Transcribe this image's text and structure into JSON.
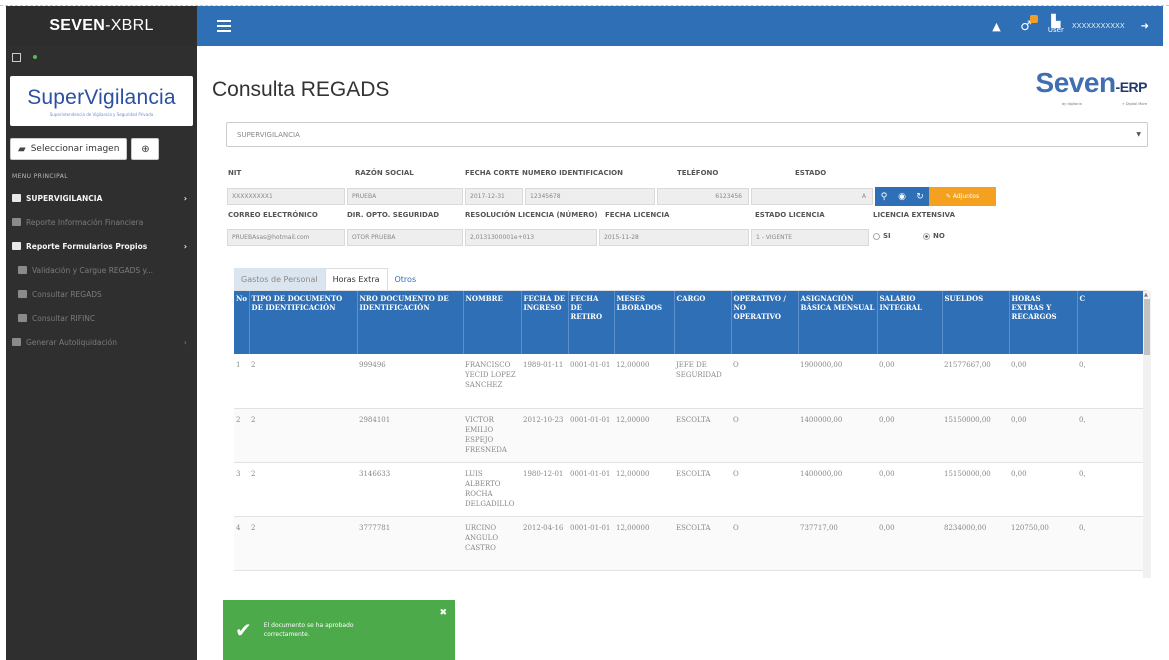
{
  "header": {
    "brand_strong": "SEVEN",
    "brand_rest": "-XBRL",
    "user_caption": "User",
    "username": "XXXXXXXXXXX"
  },
  "sidebar": {
    "logo_title": "SuperVigilancia",
    "logo_sub": "Superintendencia de Vigilancia y Seguridad Privada",
    "select_image_label": "Seleccionar imagen",
    "menu_title": "MENU PRINCIPAL",
    "items": [
      {
        "label": "SUPERVIGILANCIA"
      },
      {
        "label": "Reporte Información Financiera"
      },
      {
        "label": "Reporte Formularios Propios"
      },
      {
        "label": "Validación y Cargue REGADS y..."
      },
      {
        "label": "Consultar REGADS"
      },
      {
        "label": "Consultar RIFINC"
      },
      {
        "label": "Generar Autoliquidación"
      }
    ]
  },
  "main": {
    "title": "Consulta REGADS",
    "logo_main": "Seven",
    "logo_suffix": "-ERP",
    "logo_tag_left": "by digitaria",
    "logo_tag_right": "+ Digital More",
    "company": "SUPERVIGILANCIA"
  },
  "form": {
    "nit_label": "NIT",
    "nit": "XXXXXXXXX1",
    "razon_label": "RAZÓN SOCIAL",
    "razon": "PRUEBA",
    "fecha_corte_label": "FECHA CORTE",
    "fecha_corte": "2017-12-31",
    "num_id_label": "NUMERO IDENTIFICACION",
    "num_id": "12345678",
    "telefono_label": "TELÉFONO",
    "telefono": "6123456",
    "estado_label": "ESTADO",
    "estado": "A",
    "correo_label": "CORREO ELECTRÓNICO",
    "correo": "PRUEBAsas@hotmail.com",
    "dir_label": "DIR. OPTO. SEGURIDAD",
    "dir": "OTOR PRUEBA",
    "resolucion_label": "RESOLUCIÓN LICENCIA (NÚMERO)",
    "resolucion": "2,0131300001e+013",
    "fecha_lic_label": "FECHA LICENCIA",
    "fecha_lic": "2015-11-28",
    "estado_lic_label": "ESTADO LICENCIA",
    "estado_lic": "1 - VIGENTE",
    "lic_ext_label": "LICENCIA EXTENSIVA",
    "si_label": "SI",
    "no_label": "NO",
    "adjuntos_label": "Adjuntos"
  },
  "tabs": [
    {
      "label": "Gastos de Personal"
    },
    {
      "label": "Horas Extra"
    },
    {
      "label": "Otros"
    }
  ],
  "table": {
    "columns": [
      "No",
      "TIPO DE DOCUMENTO DE IDENTIFICACIÓN",
      "NRO DOCUMENTO DE IDENTIFICACIÓN",
      "NOMBRE",
      "FECHA DE INGRESO",
      "FECHA DE RETIRO",
      "MESES LBORADOS",
      "CARGO",
      "OPERATIVO / NO OPERATIVO",
      "ASIGNACIÓN BÁSICA MENSUAL",
      "SALARIO INTEGRAL",
      "SUELDOS",
      "HORAS EXTRAS Y RECARGOS",
      "C"
    ],
    "rows": [
      [
        "1",
        "2",
        "999496",
        "FRANCISCO YECID LOPEZ SANCHEZ",
        "1989-01-11",
        "0001-01-01",
        "12,00000",
        "JEFE DE SEGURIDAD",
        "O",
        "1900000,00",
        "0,00",
        "21577667,00",
        "0,00",
        "0,"
      ],
      [
        "2",
        "2",
        "2984101",
        "VICTOR EMILIO ESPEJO FRESNEDA",
        "2012-10-23",
        "0001-01-01",
        "12,00000",
        "ESCOLTA",
        "O",
        "1400000,00",
        "0,00",
        "15150000,00",
        "0,00",
        "0,"
      ],
      [
        "3",
        "2",
        "3146633",
        "LUIS ALBERTO ROCHA DELGADILLO",
        "1980-12-01",
        "0001-01-01",
        "12,00000",
        "ESCOLTA",
        "O",
        "1400000,00",
        "0,00",
        "15150000,00",
        "0,00",
        "0,"
      ],
      [
        "4",
        "2",
        "3777781",
        "URCINO ANGULO CASTRO",
        "2012-04-16",
        "0001-01-01",
        "12,00000",
        "ESCOLTA",
        "O",
        "737717,00",
        "0,00",
        "8234000,00",
        "120750,00",
        "0,"
      ]
    ]
  },
  "toast": {
    "message": "El documento se ha aprobado correctamente."
  }
}
